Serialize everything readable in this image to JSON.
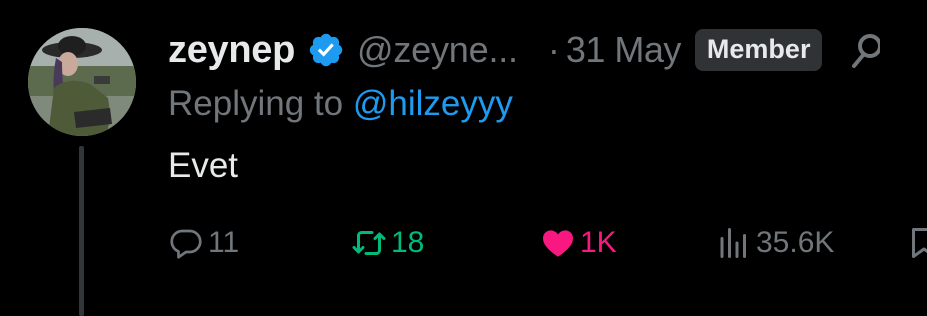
{
  "tweet": {
    "display_name": "zeynep",
    "handle": "@zeyne...",
    "separator": "·",
    "date": "31 May",
    "badge": "Member",
    "replying_prefix": "Replying to ",
    "replying_to": "@hilzeyyy",
    "text": "Evet",
    "stats": {
      "replies": "11",
      "retweets": "18",
      "likes": "1K",
      "views": "35.6K"
    }
  },
  "colors": {
    "background": "#000000",
    "primary_text": "#e7e9ea",
    "secondary_text": "#71767b",
    "link": "#1d9bf0",
    "retweet_active": "#00ba7c",
    "like_active": "#f91880",
    "verified": "#1d9bf0"
  },
  "icons": [
    "verified-icon",
    "more-icon",
    "reply-icon",
    "retweet-icon",
    "like-icon",
    "views-icon",
    "bookmark-icon"
  ]
}
